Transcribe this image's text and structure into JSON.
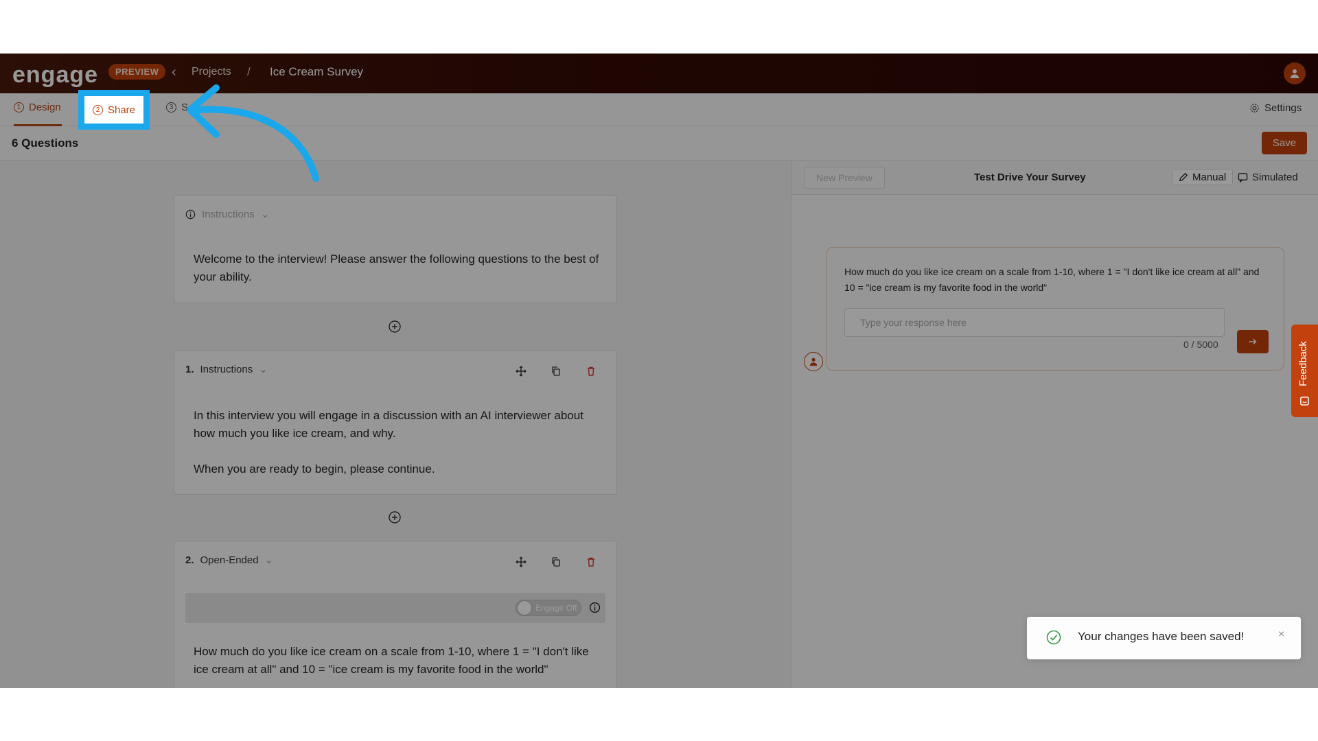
{
  "topbar": {
    "logo_text": "engage",
    "preview_badge": "PREVIEW",
    "breadcrumb_projects": "Projects",
    "breadcrumb_separator": "/",
    "breadcrumb_current": "Ice Cream Survey"
  },
  "tabs": {
    "design": {
      "num": "1",
      "label": "Design"
    },
    "share": {
      "num": "2",
      "label": "Share"
    },
    "third": {
      "num": "3",
      "label": "S"
    },
    "settings": "Settings"
  },
  "subheader": {
    "question_count": "6 Questions",
    "save_label": "Save"
  },
  "cards": [
    {
      "type_label": "Instructions",
      "body": "Welcome to the interview! Please answer the following questions to the best of your ability."
    },
    {
      "num": "1.",
      "type_label": "Instructions",
      "body_p1": "In this interview you will engage in a discussion with an AI interviewer about how much you like ice cream, and why.",
      "body_p2": "When you are ready to begin, please continue."
    },
    {
      "num": "2.",
      "type_label": "Open-Ended",
      "toggle_label": "Engage Off",
      "body": "How much do you like ice cream on a scale from 1-10, where 1 = \"I don't like ice cream at all\" and 10 = \"ice cream is my favorite food in the world\""
    }
  ],
  "preview": {
    "new_preview_label": "New Preview",
    "title": "Test Drive Your Survey",
    "mode_manual": "Manual",
    "mode_simulated": "Simulated",
    "question": "How much do you like ice cream on a scale from 1-10, where 1 = \"I don't like ice cream at all\" and 10 = \"ice cream is my favorite food in the world\"",
    "response_placeholder": "Type your response here",
    "char_count": "0 / 5000"
  },
  "feedback_label": "Feedback",
  "toast": {
    "message": "Your changes have been saved!",
    "close": "×"
  },
  "colors": {
    "brand": "#c2410c",
    "highlight": "#1aa7ec",
    "topbar": "#350c06"
  }
}
